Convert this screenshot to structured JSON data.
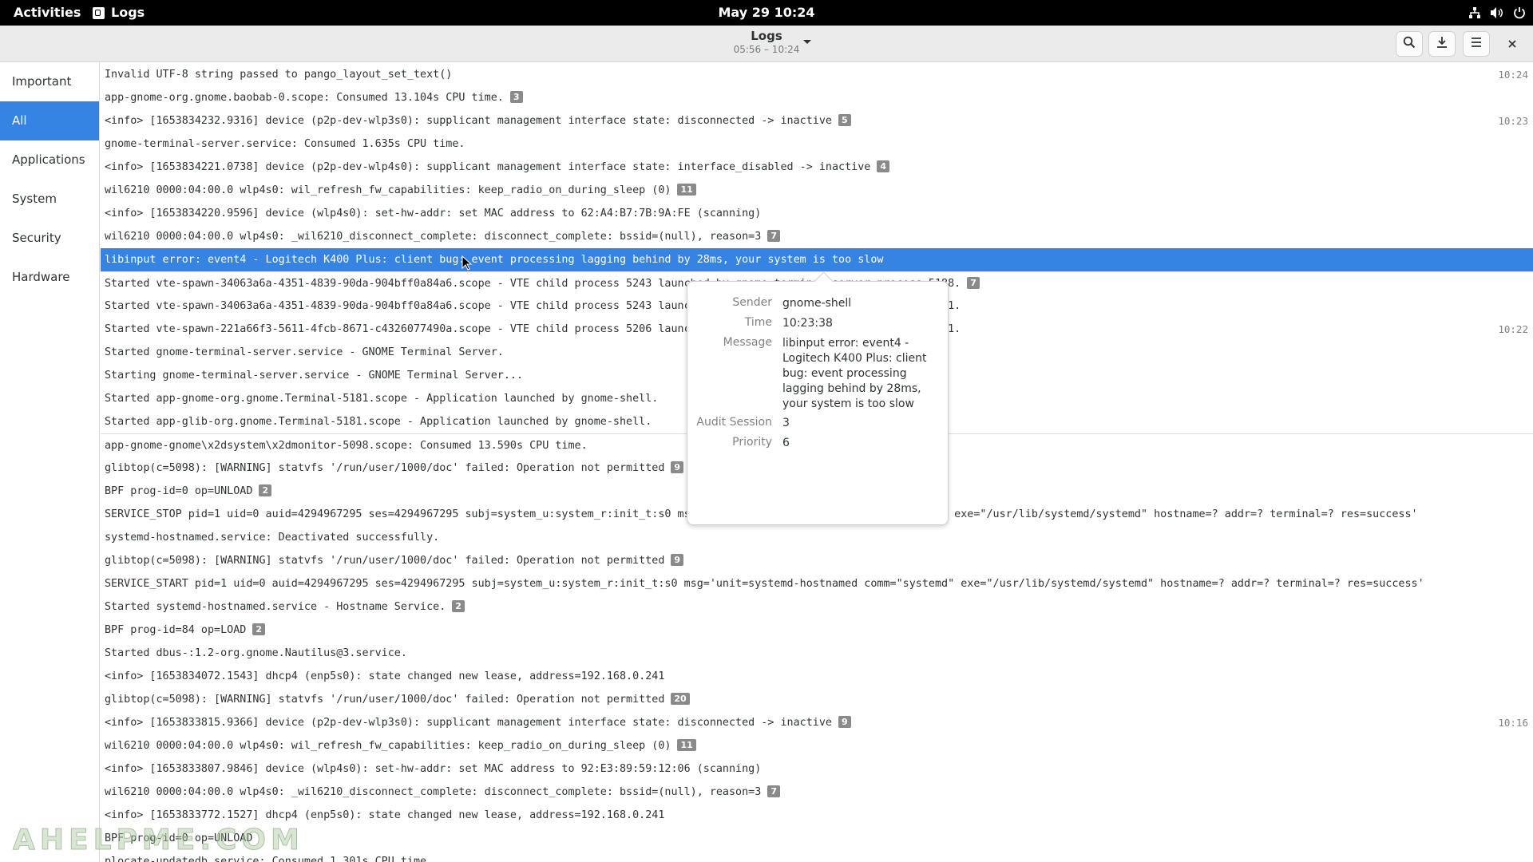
{
  "topbar": {
    "activities": "Activities",
    "app_name": "Logs",
    "clock": "May 29  10:24",
    "icons": [
      "network-icon",
      "volume-icon",
      "power-icon"
    ]
  },
  "header": {
    "title": "Logs",
    "subtitle": "05:56 – 10:24",
    "icons": [
      "search-icon",
      "export-icon",
      "hamburger-menu-icon",
      "close-icon"
    ]
  },
  "sidebar": {
    "items": [
      {
        "label": "Important"
      },
      {
        "label": "All"
      },
      {
        "label": "Applications"
      },
      {
        "label": "System"
      },
      {
        "label": "Security"
      },
      {
        "label": "Hardware"
      }
    ],
    "selected": "All"
  },
  "log_rows": [
    {
      "text": "Invalid UTF-8 string passed to pango_layout_set_text()",
      "count": "",
      "time": "10:24"
    },
    {
      "text": "app-gnome-org.gnome.baobab-0.scope: Consumed 13.104s CPU time.",
      "count": "3",
      "time": ""
    },
    {
      "text": "<info>  [1653834232.9316] device (p2p-dev-wlp3s0): supplicant management interface state: disconnected -> inactive",
      "count": "5",
      "time": "10:23"
    },
    {
      "text": "gnome-terminal-server.service: Consumed 1.635s CPU time.",
      "count": "",
      "time": ""
    },
    {
      "text": "<info>  [1653834221.0738] device (p2p-dev-wlp4s0): supplicant management interface state: interface_disabled -> inactive",
      "count": "4",
      "time": ""
    },
    {
      "text": "wil6210 0000:04:00.0 wlp4s0: wil_refresh_fw_capabilities: keep_radio_on_during_sleep (0)",
      "count": "11",
      "time": ""
    },
    {
      "text": "<info>  [1653834220.9596] device (wlp4s0): set-hw-addr: set MAC address to 62:A4:B7:7B:9A:FE (scanning)",
      "count": "",
      "time": ""
    },
    {
      "text": "wil6210 0000:04:00.0 wlp4s0: _wil6210_disconnect_complete: disconnect_complete: bssid=(null), reason=3",
      "count": "7",
      "time": ""
    },
    {
      "text": "libinput error: event4  - Logitech K400 Plus: client bug: event processing lagging behind by 28ms, your system is too slow",
      "count": "",
      "time": "",
      "selected": true
    },
    {
      "text": "Started vte-spawn-34063a6a-4351-4839-90da-904bff0a84a6.scope - VTE child process 5243 launched by gnome-terminal-server process 5188.",
      "count": "7",
      "time": ""
    },
    {
      "text": "Started vte-spawn-34063a6a-4351-4839-90da-904bff0a84a6.scope - VTE child process 5243 launched by gnome-terminal-server process 5181.",
      "count": "",
      "time": ""
    },
    {
      "text": "Started vte-spawn-221a66f3-5611-4fcb-8671-c4326077490a.scope - VTE child process 5206 launched by gnome-terminal-server process 5181.",
      "count": "",
      "time": "10:22"
    },
    {
      "text": "Started gnome-terminal-server.service - GNOME Terminal Server.",
      "count": "",
      "time": ""
    },
    {
      "text": "Starting gnome-terminal-server.service - GNOME Terminal Server...",
      "count": "",
      "time": ""
    },
    {
      "text": "Started app-gnome-org.gnome.Terminal-5181.scope - Application launched by gnome-shell.",
      "count": "",
      "time": ""
    },
    {
      "text": "Started app-glib-org.gnome.Terminal-5181.scope - Application launched by gnome-shell.",
      "count": "",
      "time": ""
    },
    {
      "text": "app-gnome-gnome\\x2dsystem\\x2dmonitor-5098.scope: Consumed 13.590s CPU time.",
      "count": "",
      "time": ""
    },
    {
      "text": "glibtop(c=5098): [WARNING] statvfs '/run/user/1000/doc' failed: Operation not permitted",
      "count": "9",
      "time": ""
    },
    {
      "text": "BPF prog-id=0 op=UNLOAD",
      "count": "2",
      "time": ""
    },
    {
      "text": "SERVICE_STOP pid=1 uid=0 auid=4294967295 ses=4294967295 subj=system_u:system_r:init_t:s0 msg='unit=systemd-hostnamed comm=\"systemd\" exe=\"/usr/lib/systemd/systemd\" hostname=? addr=? terminal=? res=success'",
      "count": "",
      "time": ""
    },
    {
      "text": "systemd-hostnamed.service: Deactivated successfully.",
      "count": "",
      "time": ""
    },
    {
      "text": "glibtop(c=5098): [WARNING] statvfs '/run/user/1000/doc' failed: Operation not permitted",
      "count": "9",
      "time": ""
    },
    {
      "text": "SERVICE_START pid=1 uid=0 auid=4294967295 ses=4294967295 subj=system_u:system_r:init_t:s0 msg='unit=systemd-hostnamed comm=\"systemd\" exe=\"/usr/lib/systemd/systemd\" hostname=? addr=? terminal=? res=success'",
      "count": "",
      "time": ""
    },
    {
      "text": "Started systemd-hostnamed.service - Hostname Service.",
      "count": "2",
      "time": ""
    },
    {
      "text": "BPF prog-id=84 op=LOAD",
      "count": "2",
      "time": ""
    },
    {
      "text": "Started dbus-:1.2-org.gnome.Nautilus@3.service.",
      "count": "",
      "time": ""
    },
    {
      "text": "<info>  [1653834072.1543] dhcp4 (enp5s0): state changed new lease, address=192.168.0.241",
      "count": "",
      "time": ""
    },
    {
      "text": "glibtop(c=5098): [WARNING] statvfs '/run/user/1000/doc' failed: Operation not permitted",
      "count": "20",
      "time": ""
    },
    {
      "text": "<info>  [1653833815.9366] device (p2p-dev-wlp3s0): supplicant management interface state: disconnected -> inactive",
      "count": "9",
      "time": "10:16"
    },
    {
      "text": "wil6210 0000:04:00.0 wlp4s0: wil_refresh_fw_capabilities: keep_radio_on_during_sleep (0)",
      "count": "11",
      "time": ""
    },
    {
      "text": "<info>  [1653833807.9846] device (wlp4s0): set-hw-addr: set MAC address to 92:E3:89:59:12:06 (scanning)",
      "count": "",
      "time": ""
    },
    {
      "text": "wil6210 0000:04:00.0 wlp4s0: _wil6210_disconnect_complete: disconnect_complete: bssid=(null), reason=3",
      "count": "7",
      "time": ""
    },
    {
      "text": "<info>  [1653833772.1527] dhcp4 (enp5s0): state changed new lease, address=192.168.0.241",
      "count": "",
      "time": ""
    },
    {
      "text": "BPF prog-id=0 op=UNLOAD",
      "count": "",
      "time": ""
    },
    {
      "text": "plocate-updatedb.service: Consumed 1.301s CPU time.",
      "count": "",
      "time": ""
    }
  ],
  "popover": {
    "sender_label": "Sender",
    "sender": "gnome-shell",
    "time_label": "Time",
    "time": "10:23:38",
    "message_label": "Message",
    "message": "libinput error: event4 - Logitech K400 Plus: client bug: event processing lagging behind by 28ms, your system is too slow",
    "audit_label": "Audit Session",
    "audit": "3",
    "priority_label": "Priority",
    "priority": "6"
  },
  "watermark": "AHELPME.COM",
  "colors": {
    "accent": "#3584e4",
    "topbar_bg": "#000000",
    "headerbar_bg": "#ebebeb",
    "badge": "#8a8a8a"
  }
}
